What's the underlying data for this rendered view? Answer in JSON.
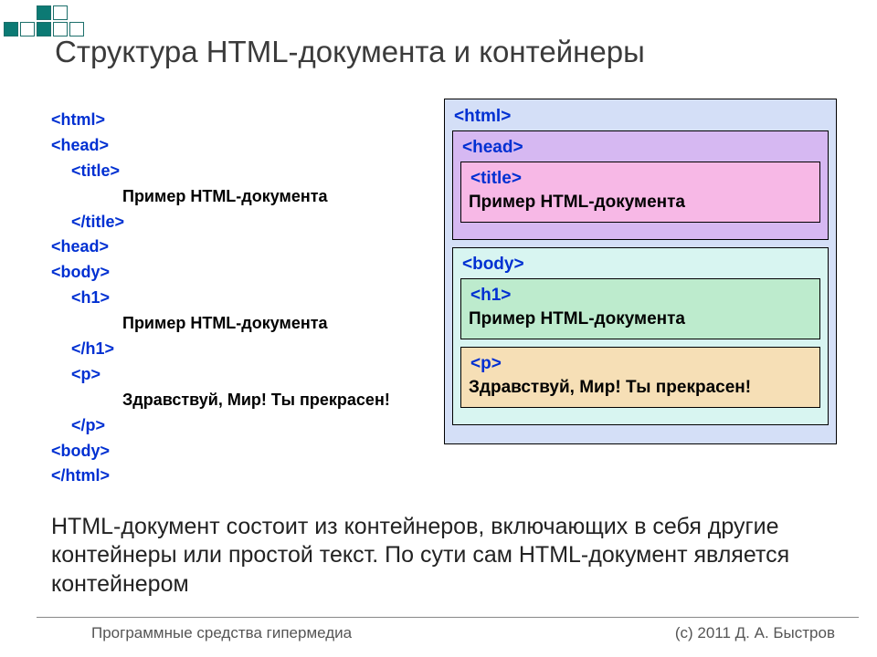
{
  "title": "Структура HTML-документа и контейнеры",
  "code": {
    "html_open": "<html>",
    "head_open": "<head>",
    "title_open": "<title>",
    "title_text": "Пример HTML-документа",
    "title_close": "</title>",
    "head_close": "<head>",
    "body_open": "<body>",
    "h1_open": "<h1>",
    "h1_text": "Пример HTML-документа",
    "h1_close": "</h1>",
    "p_open": "<p>",
    "p_text": "Здравствуй, Мир! Ты прекрасен!",
    "p_close": "</p>",
    "body_close": "<body>",
    "html_close": "</html>"
  },
  "diagram": {
    "html_tag": "<html>",
    "head_tag": "<head>",
    "title_tag": "<title>",
    "title_text": "Пример HTML-документа",
    "body_tag": "<body>",
    "h1_tag": "<h1>",
    "h1_text": "Пример HTML-документа",
    "p_tag": "<p>",
    "p_text": "Здравствуй, Мир! Ты прекрасен!"
  },
  "paragraph": "HTML-документ состоит из контейнеров, включающих в себя другие контейнеры или простой текст. По сути сам HTML-документ является контейнером",
  "footer": {
    "left": "Программные средства гипермедиа",
    "right": "(с) 2011    Д. А. Быстров"
  }
}
